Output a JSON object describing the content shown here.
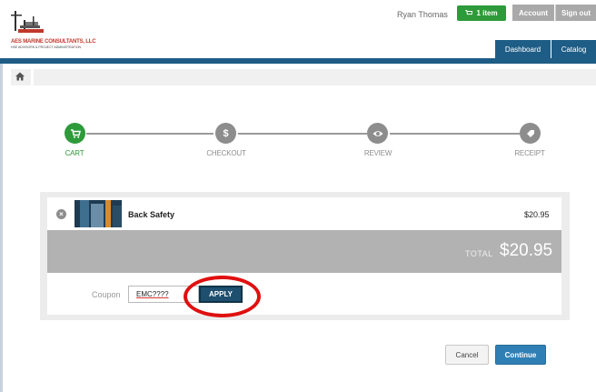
{
  "header": {
    "logo_text": "AES MARINE CONSULTANTS, LLC",
    "logo_subtext": "HSE ADVISORS & PROJECT ADMINISTRATION",
    "user_name": "Ryan Thomas",
    "cart_count_label": "1 item",
    "account_label": "Account",
    "signout_label": "Sign out",
    "nav": [
      "Dashboard",
      "Catalog"
    ]
  },
  "stepper": {
    "steps": [
      {
        "label": "CART",
        "icon": "cart-icon",
        "state": "active"
      },
      {
        "label": "CHECKOUT",
        "icon": "dollar-icon",
        "state": "inactive"
      },
      {
        "label": "REVIEW",
        "icon": "eye-icon",
        "state": "inactive"
      },
      {
        "label": "RECEIPT",
        "icon": "tag-icon",
        "state": "inactive"
      }
    ]
  },
  "cart": {
    "items": [
      {
        "name": "Back Safety",
        "price": "$20.95"
      }
    ],
    "total_label": "TOTAL",
    "total_value": "$20.95",
    "coupon_label": "Coupon",
    "coupon_value": "EMC????",
    "apply_label": "APPLY"
  },
  "actions": {
    "cancel_label": "Cancel",
    "continue_label": "Continue"
  },
  "colors": {
    "brand_blue": "#1e5d86",
    "active_green": "#2e9a3a",
    "highlight_red": "#e01010"
  }
}
